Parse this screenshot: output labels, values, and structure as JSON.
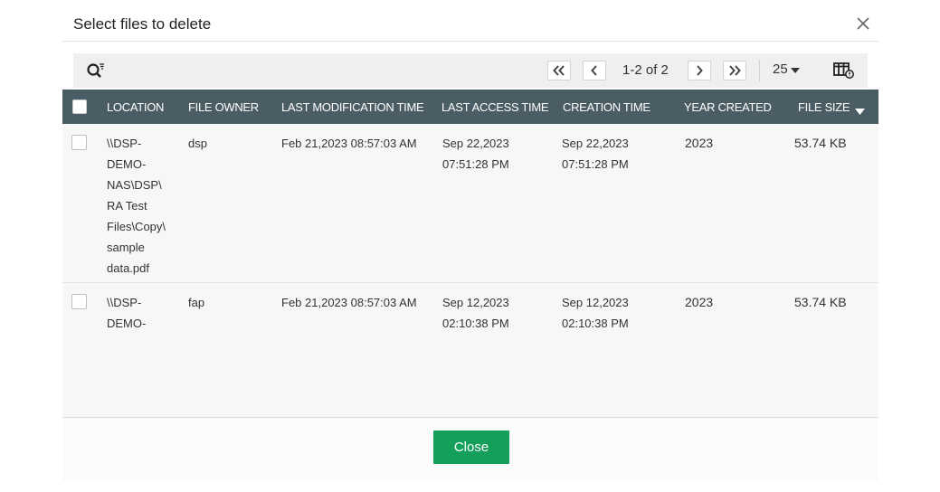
{
  "dialog": {
    "title": "Select files to delete",
    "close_icon": "close-icon"
  },
  "toolbar": {
    "search_icon": "search-filter-icon",
    "first_icon": "double-chevron-left-icon",
    "prev_icon": "chevron-left-icon",
    "page_info": "1-2 of 2",
    "next_icon": "chevron-right-icon",
    "last_icon": "double-chevron-right-icon",
    "page_size": "25",
    "columns_icon": "column-chooser-icon"
  },
  "table": {
    "headers": {
      "location": "LOCATION",
      "file_owner": "FILE OWNER",
      "last_modification_time": "LAST MODIFICATION TIME",
      "last_access_time": "LAST ACCESS TIME",
      "creation_time": "CREATION TIME",
      "year_created": "YEAR CREATED",
      "file_size": "FILE SIZE"
    },
    "sort_icon": "sort-descending-icon",
    "rows": [
      {
        "location": "\\\\DSP-\nDEMO-\nNAS\\DSP\\\nRA Test\nFiles\\Copy\\\nsample\ndata.pdf",
        "file_owner": "dsp",
        "last_modification_time": "Feb 21,2023 08:57:03 AM",
        "last_access_time": "Sep 22,2023\n07:51:28 PM",
        "creation_time": "Sep 22,2023\n07:51:28 PM",
        "year_created": "2023",
        "file_size": "53.74 KB"
      },
      {
        "location": "\\\\DSP-\nDEMO-",
        "file_owner": "fap",
        "last_modification_time": "Feb 21,2023 08:57:03 AM",
        "last_access_time": "Sep 12,2023\n02:10:38 PM",
        "creation_time": "Sep 12,2023\n02:10:38 PM",
        "year_created": "2023",
        "file_size": "53.74 KB"
      }
    ]
  },
  "footer": {
    "close_label": "Close"
  },
  "colors": {
    "header_bg": "#4a5d64",
    "toolbar_bg": "#efefef",
    "close_button": "#14a05a",
    "body_bg": "#f7f7f7"
  }
}
